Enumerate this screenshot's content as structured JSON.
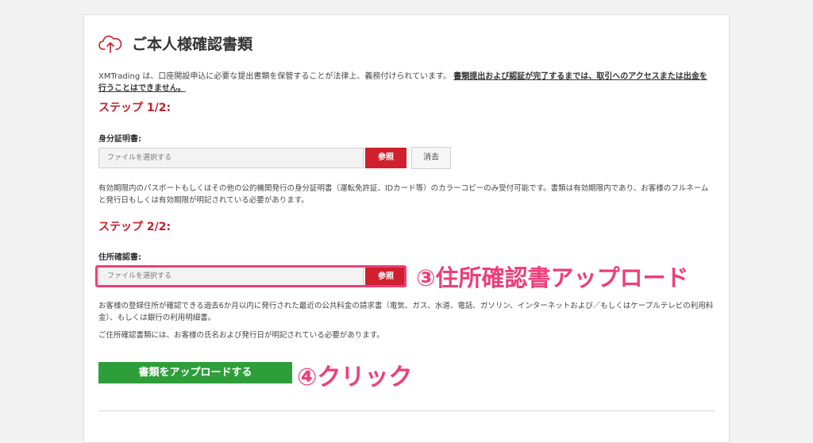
{
  "header": {
    "title": "ご本人様確認書類",
    "icon": "cloud-upload-icon"
  },
  "intro": {
    "text": "XMTrading は、口座開設申込に必要な提出書類を保管することが法律上、義務付けられています。",
    "emphasis": "書類提出および認証が完了するまでは、取引へのアクセスまたは出金を行うことはできません。"
  },
  "step1": {
    "heading": "ステップ 1/2:",
    "label": "身分証明書:",
    "placeholder": "ファイルを選択する",
    "browse_label": "参照",
    "clear_label": "消去",
    "note": "有効期限内のパスポートもしくはその他の公的機関発行の身分証明書（運転免許証、IDカード等）のカラーコピーのみ受付可能です。書類は有効期限内であり、お客様のフルネームと発行日もしくは有効期限が明記されている必要があります。"
  },
  "step2": {
    "heading": "ステップ 2/2:",
    "label": "住所確認書:",
    "placeholder": "ファイルを選択する",
    "browse_label": "参照",
    "note": "お客様の登録住所が確認できる過去6か月以内に発行された最近の公共料金の請求書（電気、ガス、水道、電話、ガソリン、インターネットおよび／もしくはケーブルテレビの利用料金）、もしくは銀行の利用明細書。",
    "note2": "ご住所確認書類には、お客様の氏名および発行日が明記されている必要があります。"
  },
  "upload_button": "書類をアップロードする",
  "annotations": {
    "step3": "③住所確認書アップロード",
    "step4": "④クリック"
  },
  "colors": {
    "accent_red": "#d0202e",
    "annotation_pink": "#ee3e7a",
    "upload_green": "#2e9e3a"
  }
}
